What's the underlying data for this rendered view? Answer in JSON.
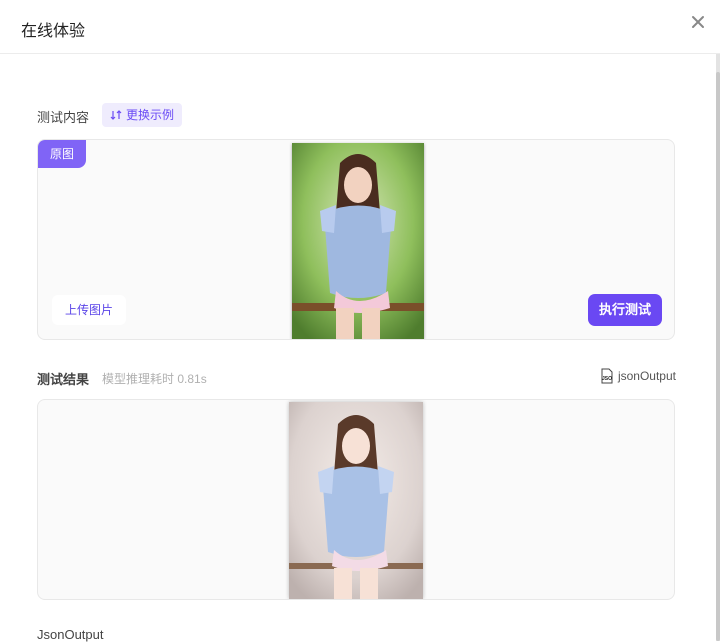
{
  "window": {
    "title": "在线体验",
    "close_icon": "close-icon"
  },
  "test_input": {
    "label": "测试内容",
    "swap_label": "更换示例",
    "original_tag": "原图",
    "upload_label": "上传图片",
    "execute_label": "执行测试"
  },
  "test_result": {
    "label": "测试结果",
    "timing_label": "模型推理耗时 0.81s",
    "json_link_label": "jsonOutput"
  },
  "json_output": {
    "label": "JsonOutput"
  },
  "colors": {
    "accent": "#6a48f3",
    "accent_light": "#efecfd",
    "tag": "#8064f6"
  }
}
